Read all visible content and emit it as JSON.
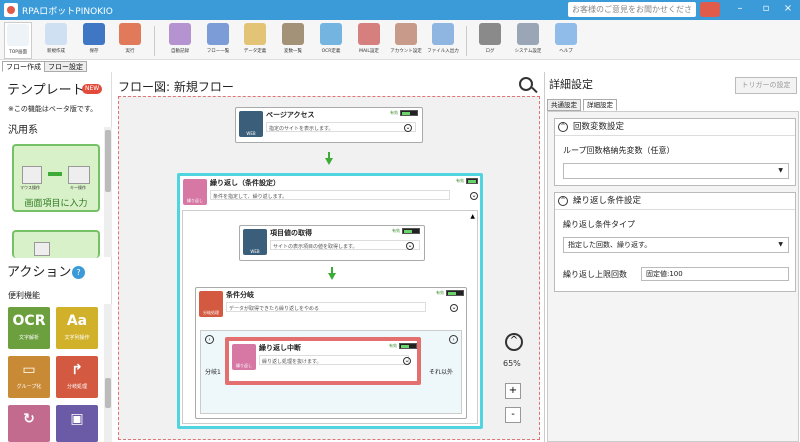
{
  "window": {
    "title": "RPAロボットPINOKIO",
    "feedback": "お客様のご意見をお聞かせください",
    "minimize": "–",
    "maximize": "▫",
    "close": "×"
  },
  "toolbar": {
    "items": [
      {
        "label": "TOP画面",
        "icon": "top-screen-icon",
        "color": "#ffffff"
      },
      {
        "label": "新規作成",
        "icon": "new-document-icon",
        "color": "#cfe0f3"
      },
      {
        "label": "保存",
        "icon": "save-icon",
        "color": "#3f77c4"
      },
      {
        "label": "実行",
        "icon": "play-icon",
        "color": "#e07a5a"
      },
      {
        "label": "自動記録",
        "icon": "record-icon",
        "color": "#b493d0"
      },
      {
        "label": "フロー一覧",
        "icon": "flow-list-icon",
        "color": "#7b9cd6"
      },
      {
        "label": "データ定義",
        "icon": "data-definition-icon",
        "color": "#e3c476"
      },
      {
        "label": "変数一覧",
        "icon": "variables-icon",
        "color": "#a39278"
      },
      {
        "label": "OCR定義",
        "icon": "ocr-folder-icon",
        "color": "#74b4e0"
      },
      {
        "label": "MAIL設定",
        "icon": "mail-icon",
        "color": "#d57f7f"
      },
      {
        "label": "アカウント設定",
        "icon": "account-icon",
        "color": "#c79a8a"
      },
      {
        "label": "ファイル入出力",
        "icon": "file-io-icon",
        "color": "#8fb6e0"
      },
      {
        "label": "ログ",
        "icon": "log-icon",
        "color": "#8a8a8a"
      },
      {
        "label": "システム設定",
        "icon": "system-settings-icon",
        "color": "#9aa6b5"
      },
      {
        "label": "ヘルプ",
        "icon": "help-icon",
        "color": "#8fbce8"
      }
    ]
  },
  "left": {
    "tabs": [
      "フロー作成",
      "フロー設定"
    ],
    "templates": {
      "title": "テンプレート",
      "badge": "NEW",
      "beta": "※この機能はベータ版です。",
      "group": "汎用系",
      "card1": "画面項目に入力",
      "card1_icons": [
        "マウス操作",
        "キー操作"
      ]
    },
    "actions": {
      "title": "アクション",
      "help": "?",
      "group": "便利機能",
      "tiles": [
        {
          "icon": "OCR",
          "label": "文字解析",
          "color": "#6c9f3e"
        },
        {
          "icon": "Aa",
          "label": "文字列操作",
          "color": "#d1b12a"
        },
        {
          "icon": "▭",
          "label": "グループ化",
          "color": "#c98a36"
        },
        {
          "icon": "↱",
          "label": "分岐処理",
          "color": "#d35a40"
        },
        {
          "icon": "↻",
          "label": "",
          "color": "#c36b8e"
        },
        {
          "icon": "▣",
          "label": "",
          "color": "#6b5aa6"
        }
      ]
    }
  },
  "flow": {
    "title": "フロー図:  新規フロー",
    "zoom": "65%",
    "zoom_in": "+",
    "zoom_out": "-",
    "zoom_up": "^",
    "status": "有効",
    "nodes": {
      "web1": {
        "title": "ページアクセス",
        "desc": "指定のサイトを表示します。",
        "icon": "WEB",
        "color": "#3b5f7a"
      },
      "loop": {
        "title": "繰り返し（条件設定）",
        "desc": "条件を指定して、繰り返します。",
        "icon": "繰り返し",
        "color": "#d777a4"
      },
      "get": {
        "title": "項目値の取得",
        "desc": "サイトの表示項目の値を取得します。",
        "icon": "WEB",
        "color": "#3b5f7a"
      },
      "cond": {
        "title": "条件分岐",
        "desc": "データが取得できたら繰り返しをやめる",
        "icon": "分岐処理",
        "color": "#d35a40"
      },
      "break": {
        "title": "繰り返し中断",
        "desc": "繰り返し処理を抜けます。",
        "icon": "繰り返し",
        "color": "#d777a4"
      }
    },
    "branch_left": "分岐1",
    "branch_right": "それ以外"
  },
  "detail": {
    "title": "詳細設定",
    "trigger": "トリガーの設定",
    "tabs": [
      "共通設定",
      "詳細設定"
    ],
    "g1": {
      "title": "回数変数設定",
      "label": "ループ回数格納先変数（任意）",
      "value": ""
    },
    "g2": {
      "title": "繰り返し条件設定",
      "type_label": "繰り返し条件タイプ",
      "type_value": "指定した回数、繰り返す。",
      "limit_label": "繰り返し上限回数",
      "limit_value": "固定値:100"
    }
  }
}
